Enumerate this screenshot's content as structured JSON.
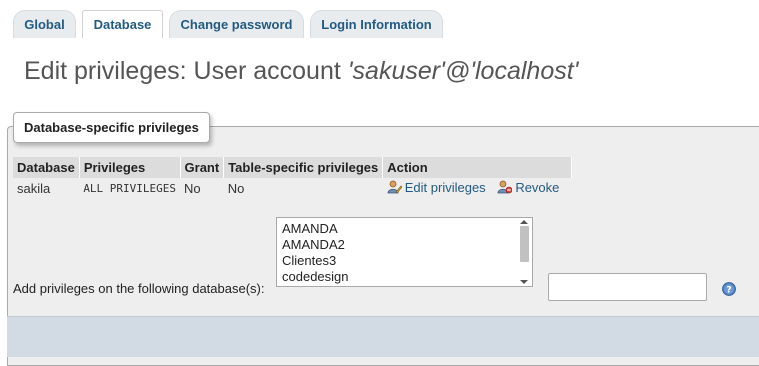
{
  "tabs": {
    "global": "Global",
    "database": "Database",
    "change_password": "Change password",
    "login_information": "Login Information",
    "active": "Database"
  },
  "page": {
    "title_prefix": "Edit privileges: User account ",
    "account": "'sakuser'@'localhost'"
  },
  "section": {
    "legend": "Database-specific privileges"
  },
  "table": {
    "headers": [
      "Database",
      "Privileges",
      "Grant",
      "Table-specific privileges",
      "Action"
    ],
    "rows": [
      {
        "database": "sakila",
        "privileges": "ALL PRIVILEGES",
        "grant": "No",
        "table_specific": "No",
        "edit_label": "Edit privileges",
        "revoke_label": "Revoke"
      }
    ]
  },
  "add_privileges": {
    "label": "Add privileges on the following database(s):",
    "options": [
      "AMANDA",
      "AMANDA2",
      "Clientes3",
      "codedesign"
    ],
    "input_value": ""
  },
  "icons": {
    "edit": "user-edit-icon",
    "revoke": "user-revoke-icon",
    "help": "help-icon"
  },
  "colors": {
    "link": "#235a81",
    "panel_bg": "#eeeeee",
    "header_bg": "#dcdcdc"
  }
}
